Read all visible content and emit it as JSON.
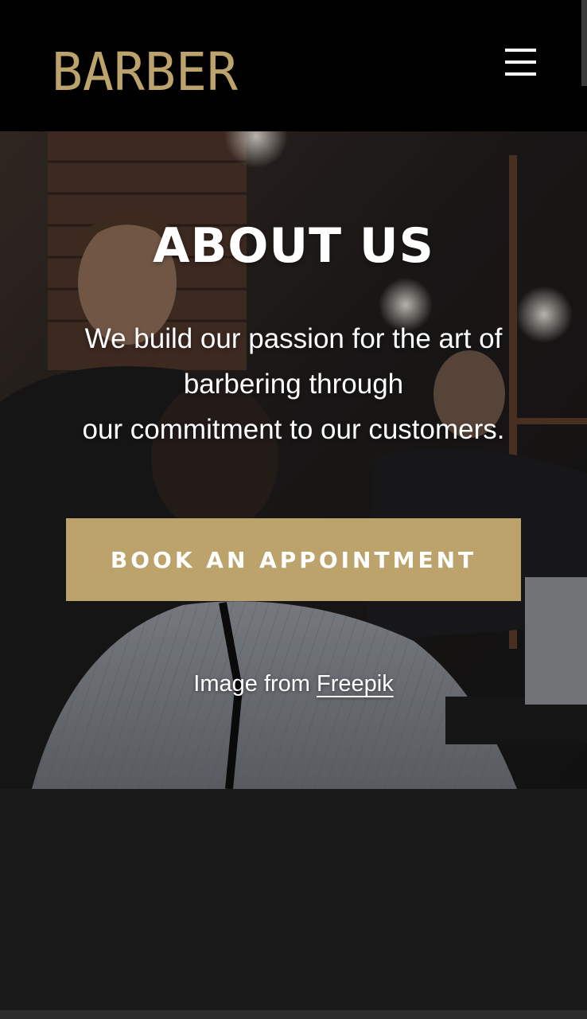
{
  "header": {
    "logo_text": "BARBER",
    "menu_icon": "hamburger-menu-icon"
  },
  "hero": {
    "title": "ABOUT US",
    "text_lines": [
      "We build our passion for the art of",
      "barbering through",
      "our commitment to our customers."
    ],
    "cta_label": "BOOK AN APPOINTMENT",
    "credit_prefix": "Image from ",
    "credit_link": "Freepik"
  },
  "colors": {
    "brand_gold": "#bca36b",
    "header_bg": "#000000",
    "page_bg": "#1a1a1a"
  }
}
